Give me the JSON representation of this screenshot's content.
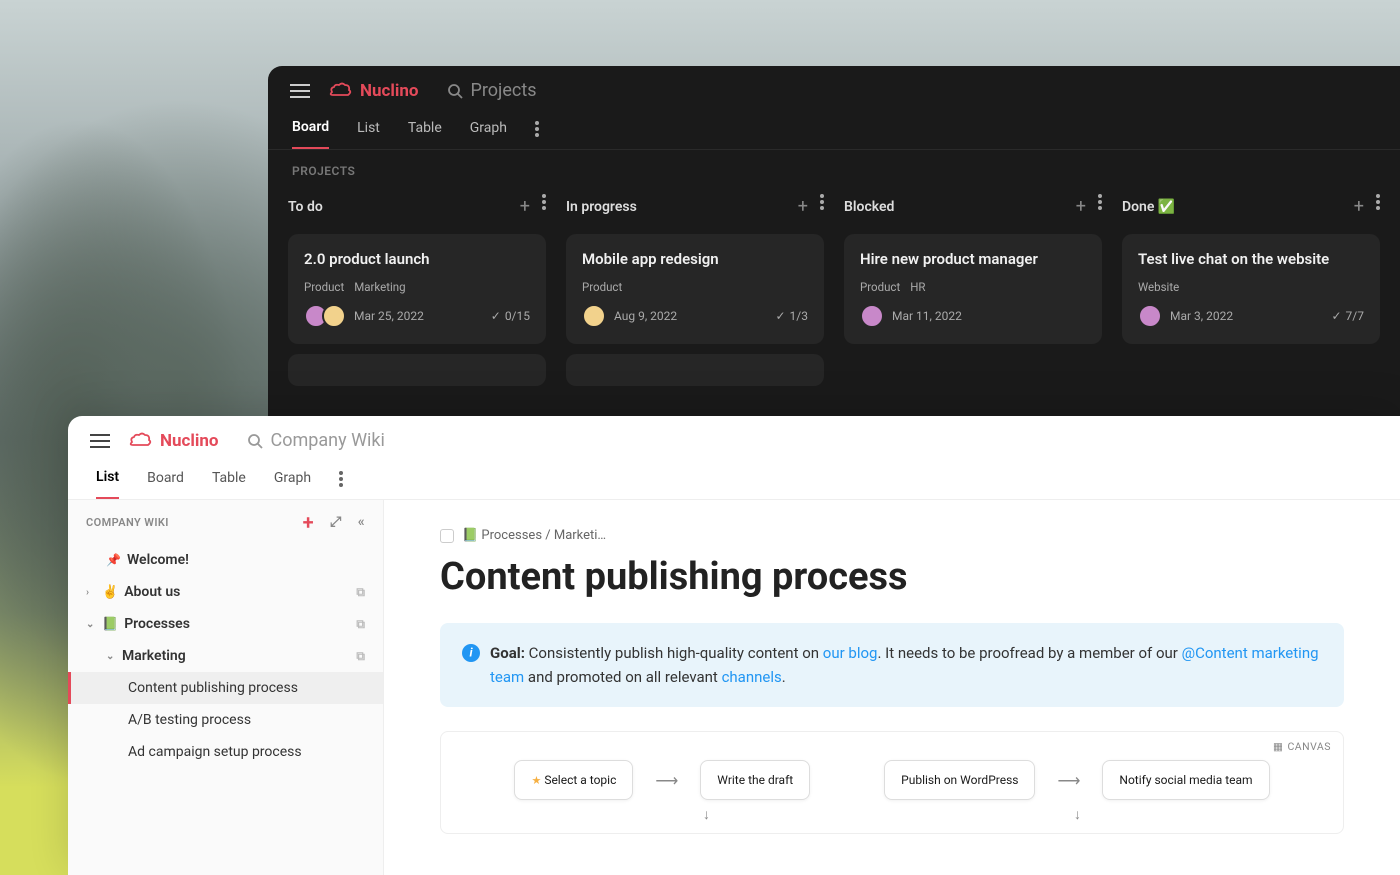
{
  "app_name": "Nuclino",
  "dark": {
    "search_placeholder": "Projects",
    "tabs": [
      "Board",
      "List",
      "Table",
      "Graph"
    ],
    "active_tab": "Board",
    "section": "PROJECTS",
    "columns": [
      {
        "title": "To do",
        "cards": [
          {
            "title": "2.0 product launch",
            "tags": [
              "Product",
              "Marketing"
            ],
            "date": "Mar 25, 2022",
            "check": "0/15",
            "avatars": 2
          }
        ]
      },
      {
        "title": "In progress",
        "cards": [
          {
            "title": "Mobile app redesign",
            "tags": [
              "Product"
            ],
            "date": "Aug 9, 2022",
            "check": "1/3",
            "avatars": 1
          }
        ]
      },
      {
        "title": "Blocked",
        "cards": [
          {
            "title": "Hire new product manager",
            "tags": [
              "Product",
              "HR"
            ],
            "date": "Mar 11, 2022",
            "check": "",
            "avatars": 1
          }
        ]
      },
      {
        "title": "Done ✅",
        "cards": [
          {
            "title": "Test live chat on the website",
            "tags": [
              "Website"
            ],
            "date": "Mar 3, 2022",
            "check": "7/7",
            "avatars": 1
          }
        ]
      }
    ]
  },
  "light": {
    "search_placeholder": "Company Wiki",
    "tabs": [
      "List",
      "Board",
      "Table",
      "Graph"
    ],
    "active_tab": "List",
    "sidebar_heading": "COMPANY WIKI",
    "tree": {
      "welcome": "Welcome!",
      "about": "About us",
      "processes": "Processes",
      "marketing": "Marketing",
      "items": [
        "Content publishing process",
        "A/B testing process",
        "Ad campaign setup process"
      ],
      "selected": "Content publishing process"
    },
    "breadcrumb": "📗 Processes / Marketi…",
    "title": "Content publishing process",
    "goal_label": "Goal:",
    "goal_text1": " Consistently publish high-quality content on ",
    "goal_link1": "our blog",
    "goal_text2": ". It needs to be proofread by a member of our ",
    "goal_link2": "@Content marketing team",
    "goal_text3": " and promoted on all relevant ",
    "goal_link3": "channels",
    "goal_text4": ".",
    "canvas_label": "CANVAS",
    "canvas_nodes": [
      "Select a topic",
      "Write the draft",
      "Publish on WordPress",
      "Notify social media team"
    ]
  }
}
